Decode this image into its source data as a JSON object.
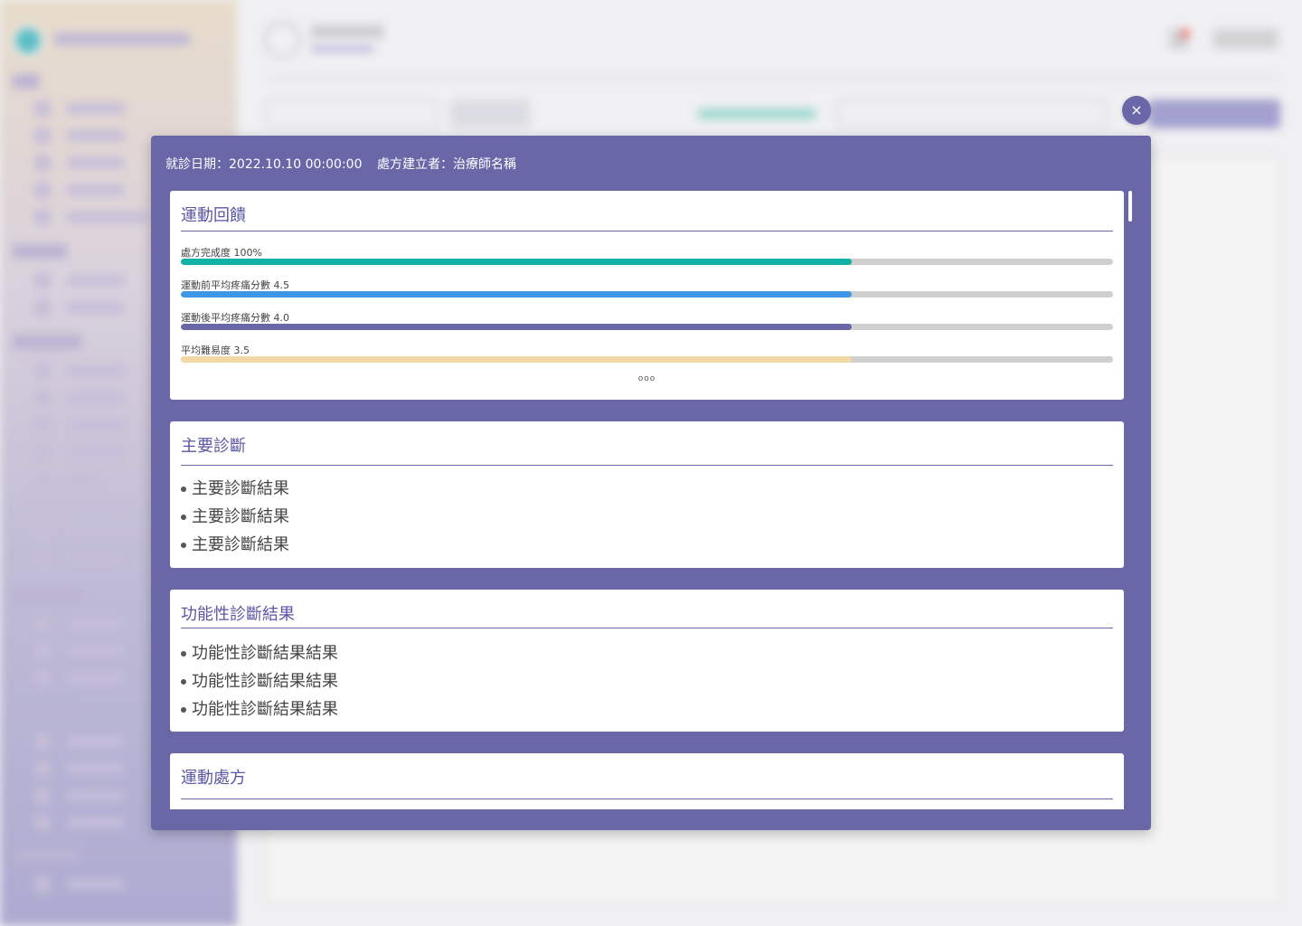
{
  "modal": {
    "visit_date": "就診日期：2022.10.10 00:00:00",
    "creator": "處方建立者：治療師名稱",
    "close_symbol": "×"
  },
  "feedback": {
    "title": "運動回饋",
    "metrics": [
      {
        "label": "處方完成度 100%",
        "value": 0.72,
        "color": "#0fb2a4"
      },
      {
        "label": "運動前平均疼痛分數 4.5",
        "value": 0.72,
        "color": "#3e97e6"
      },
      {
        "label": "運動後平均疼痛分數 4.0",
        "value": 0.72,
        "color": "#6a67a8"
      },
      {
        "label": "平均難易度 3.5",
        "value": 0.72,
        "color": "#f2d8a2"
      }
    ],
    "more": "ooo"
  },
  "primary_diagnosis": {
    "title": "主要診斷",
    "items": [
      "主要診斷結果",
      "主要診斷結果",
      "主要診斷結果"
    ]
  },
  "functional_diagnosis": {
    "title": "功能性診斷結果",
    "items": [
      "功能性診斷結果結果",
      "功能性診斷結果結果",
      "功能性診斷結果結果"
    ]
  },
  "exercise_prescription": {
    "title": "運動處方"
  }
}
